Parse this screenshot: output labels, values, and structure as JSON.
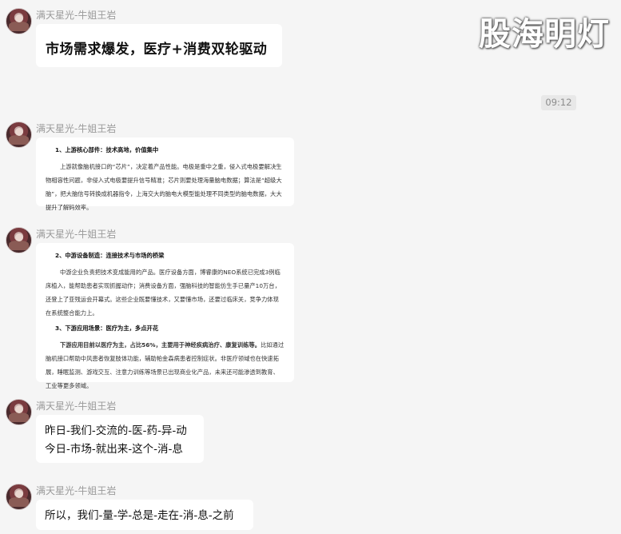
{
  "watermark": "股海明灯",
  "timestamp": "09:12",
  "messages": [
    {
      "sender": "满天星光-牛姐王岩",
      "text": "市场需求爆发，医疗+消费双轮驱动"
    },
    {
      "sender": "满天星光-牛姐王岩",
      "doc": {
        "heading": "1、上游核心部件：技术高地，价值集中",
        "paragraph": "上游就像脑机接口的“芯片”，决定着产品性能。电极是重中之重，侵入式电极要解决生物相容性问题，非侵入式电极要提升信号精准；芯片则要处理海量脑电数据；算法是“超级大脑”，把大脑信号转换成机器指令，上海交大的脑电大模型能处理不同类型的脑电数据，大大提升了解码效率。"
      }
    },
    {
      "sender": "满天星光-牛姐王岩",
      "doc": {
        "heading": "2、中游设备制造：连接技术与市场的桥梁",
        "paragraph": "中游企业负责把技术变成能用的产品。医疗设备方面，博睿康的NEO系统已完成3例临床植入，能帮助患者实现抓握动作；消费设备方面，强脑科技的智能仿生手已量产10万台，还登上了亚残运会开幕式。这些企业既要懂技术，又要懂市场，还要过临床关，竞争力体现在系统整合能力上。",
        "heading2": "3、下游应用场景：医疗为主，多点开花",
        "paragraph2_bold": "下游应用目前以医疗为主，占比56%，主要用于神经疾病治疗、康复训练等。",
        "paragraph2": "比如通过脑机接口帮助中风患者恢复肢体功能，辅助帕金森病患者控制症状。非医疗领域也在快速拓展，睡眠监测、游戏交互、注意力训练等场景已出现商业化产品，未来还可能渗透到教育、工业等更多领域。"
      }
    },
    {
      "sender": "满天星光-牛姐王岩",
      "lines": [
        "昨日-我们-交流的-医-药-异-动",
        "今日-市场-就出来-这个-消-息"
      ]
    },
    {
      "sender": "满天星光-牛姐王岩",
      "text": "所以，我们-量-学-总是-走在-消-息-之前"
    }
  ]
}
